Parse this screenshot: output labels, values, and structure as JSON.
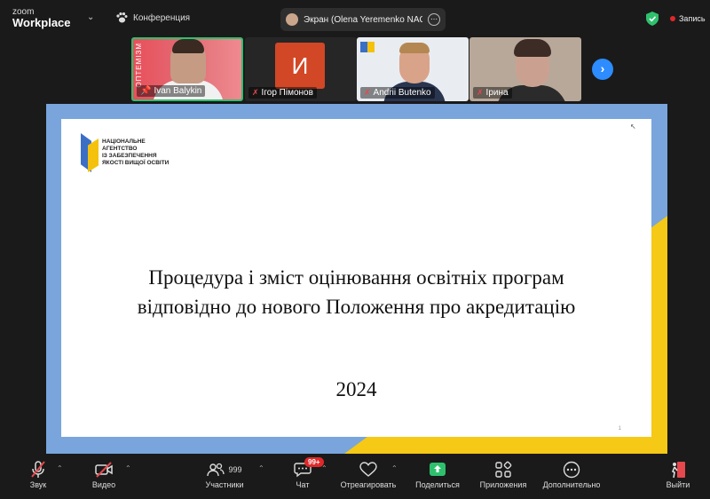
{
  "app": {
    "logo_line1": "zoom",
    "logo_line2": "Workplace"
  },
  "topbar": {
    "conference_label": "Конференция",
    "screen_share_label": "Экран (Olena Yeremenko NAQA)",
    "record_label": "Запись",
    "colors": {
      "record_dot": "#e02828",
      "shield": "#2fc06e"
    }
  },
  "participants": [
    {
      "name": "Ivan Balykin",
      "muted": false,
      "active_speaker": true,
      "side_text": "ОПТЕМІЗМ"
    },
    {
      "name": "Ігор Пімонов",
      "muted": true,
      "avatar_letter": "И"
    },
    {
      "name": "Andrii Butenko",
      "muted": true
    },
    {
      "name": "Ірина",
      "muted": true
    }
  ],
  "slide": {
    "logo_lines": [
      "НАЦІОНАЛЬНЕ",
      "АГЕНТСТВО",
      "ІЗ ЗАБЕЗПЕЧЕННЯ",
      "ЯКОСТІ ВИЩОЇ ОСВІТИ"
    ],
    "title_line1": "Процедура і зміст оцінювання освітніх програм",
    "title_line2": "відповідно до нового Положення про акредитацію",
    "year": "2024",
    "page_number": "1",
    "colors": {
      "blue": "#79a5dc",
      "yellow": "#f5c915"
    }
  },
  "toolbar": {
    "audio": "Звук",
    "video": "Видео",
    "participants": "Участники",
    "participants_count": "999",
    "chat": "Чат",
    "chat_badge": "99+",
    "react": "Отреагировать",
    "share": "Поделиться",
    "apps": "Приложения",
    "more": "Дополнительно",
    "leave": "Выйти",
    "colors": {
      "share_green": "#2fc06e",
      "muted_red": "#e5484d"
    }
  }
}
